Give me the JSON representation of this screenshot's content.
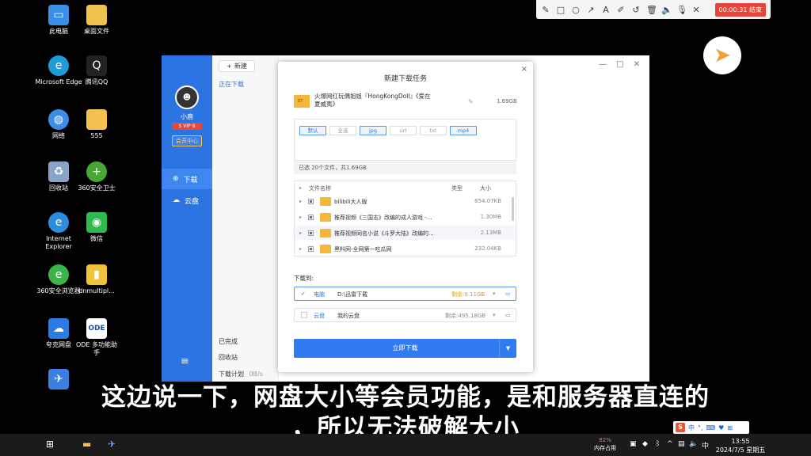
{
  "desktop_icons": [
    {
      "label": "此电脑",
      "icon": "computer-icon",
      "color": "#3b8ee8"
    },
    {
      "label": "桌面文件",
      "icon": "folder-icon",
      "color": "#f2c14e"
    },
    {
      "label": "Microsoft Edge",
      "icon": "edge-icon",
      "color": "#1f9bd8"
    },
    {
      "label": "腾讯QQ",
      "icon": "qq-icon",
      "color": "#222222"
    },
    {
      "label": "网络",
      "icon": "network-icon",
      "color": "#3b8ee8"
    },
    {
      "label": "555",
      "icon": "folder-icon",
      "color": "#f2c14e"
    },
    {
      "label": "回收站",
      "icon": "recycle-bin-icon",
      "color": "#8aa4c8"
    },
    {
      "label": "360安全卫士",
      "icon": "plus-icon",
      "color": "#46a832"
    },
    {
      "label": "Internet Explorer",
      "icon": "ie-icon",
      "color": "#2a8ee0"
    },
    {
      "label": "微信",
      "icon": "wechat-icon",
      "color": "#2dba4e"
    },
    {
      "label": "360安全浏览器",
      "icon": "360-browser-icon",
      "color": "#3bb54a"
    },
    {
      "label": "dnmultipl...",
      "icon": "battery-icon",
      "color": "#f3c23b"
    },
    {
      "label": "夸克网盘",
      "icon": "cloud-icon",
      "color": "#2a7be4"
    },
    {
      "label": "ODE 多功能助手",
      "icon": "ode-icon",
      "color": "#ffffff"
    }
  ],
  "recorder": {
    "timer": "00:00:31 结束"
  },
  "app": {
    "new_button": "新建",
    "user_name": "小鹿",
    "vip": "S VIP 8",
    "member_center": "会员中心",
    "nav_download": "下载",
    "nav_cloud": "云盘",
    "list_downloading": "正在下载",
    "list_completed": "已完成",
    "list_recycle": "回收站",
    "list_plan": "下载计划",
    "list_speed": "0B/s"
  },
  "dialog": {
    "title": "新建下载任务",
    "task_name": "火爆网红玩偶姐姐『HongKongDoll』《爱在夏威夷》",
    "task_size": "1.69GB",
    "folder_badge": "BT",
    "filters": [
      "默认",
      "全选",
      "jpg",
      "url",
      "txt",
      "mp4"
    ],
    "selected_summary": "已选 20个文件，共1.69GB",
    "col_name": "文件名称",
    "col_type": "类型",
    "col_size": "大小",
    "files": [
      {
        "name": "bilibili大人版",
        "size": "654.07KB"
      },
      {
        "name": "推荐视频《三国志》改编的成人游戏 -...",
        "size": "1.30MB"
      },
      {
        "name": "推荐视频同名小说《斗罗大陆》改编的...",
        "size": "2.13MB"
      },
      {
        "name": "黑料网-全网第一吃瓜网",
        "size": "232.04KB"
      }
    ],
    "dest_label": "下载到:",
    "dest_pc_label": "电脑",
    "dest_pc_path": "D:\\迅雷下载",
    "dest_pc_free": "剩余:9.11GB",
    "dest_cloud_label": "云盘",
    "dest_cloud_path": "我的云盘",
    "dest_cloud_free": "剩余:495.18GB",
    "download_button": "立即下载"
  },
  "subtitles": {
    "line1": "这边说一下，网盘大小等会员功能，是和服务器直连的",
    "line2": "，所以无法破解大小"
  },
  "taskbar": {
    "memory_pct": "82%",
    "memory_label": "内存占用",
    "ime_lang": "中",
    "time": "13:55",
    "date": "2024/7/5 星期五"
  },
  "ime_bar": {
    "label": "中"
  }
}
